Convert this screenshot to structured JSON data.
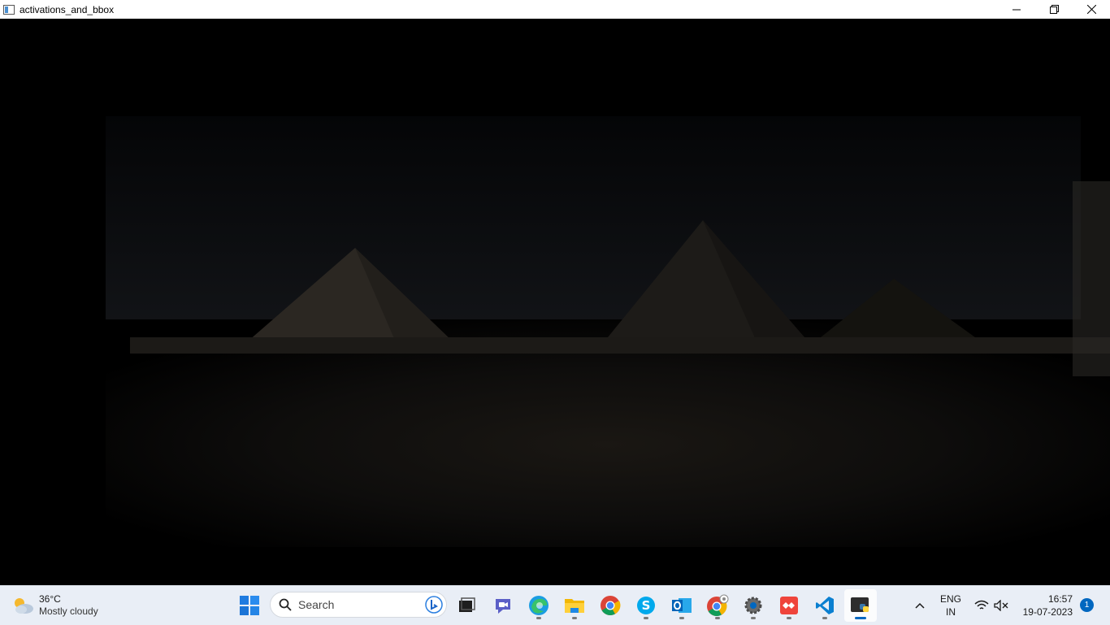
{
  "window": {
    "title": "activations_and_bbox",
    "controls": {
      "minimize": "minimize-icon",
      "restore": "restore-icon",
      "close": "close-icon"
    }
  },
  "canvas": {
    "content": "dark-image-pyramids",
    "background": "#000000"
  },
  "taskbar": {
    "weather": {
      "temperature": "36°C",
      "condition": "Mostly cloudy",
      "icon": "partly-cloudy-icon"
    },
    "search": {
      "placeholder": "Search"
    },
    "apps": [
      {
        "name": "start",
        "icon": "windows-start-icon",
        "running": false
      },
      {
        "name": "task-view",
        "icon": "task-view-icon",
        "running": false
      },
      {
        "name": "chat",
        "icon": "teams-chat-icon",
        "running": false
      },
      {
        "name": "edge",
        "icon": "edge-icon",
        "running": true
      },
      {
        "name": "file-explorer",
        "icon": "folder-icon",
        "running": true
      },
      {
        "name": "chrome",
        "icon": "chrome-icon",
        "running": false
      },
      {
        "name": "skype",
        "icon": "skype-icon",
        "running": true
      },
      {
        "name": "outlook",
        "icon": "outlook-icon",
        "running": true
      },
      {
        "name": "chrome-profile",
        "icon": "chrome-icon",
        "running": true
      },
      {
        "name": "settings",
        "icon": "gear-icon",
        "running": true
      },
      {
        "name": "anydesk",
        "icon": "anydesk-icon",
        "running": true
      },
      {
        "name": "vscode",
        "icon": "vscode-icon",
        "running": true
      },
      {
        "name": "python",
        "icon": "python-icon",
        "running": true,
        "active": true
      }
    ],
    "tray": {
      "language": {
        "line1": "ENG",
        "line2": "IN"
      },
      "time": "16:57",
      "date": "19-07-2023",
      "notifications": "1"
    }
  }
}
